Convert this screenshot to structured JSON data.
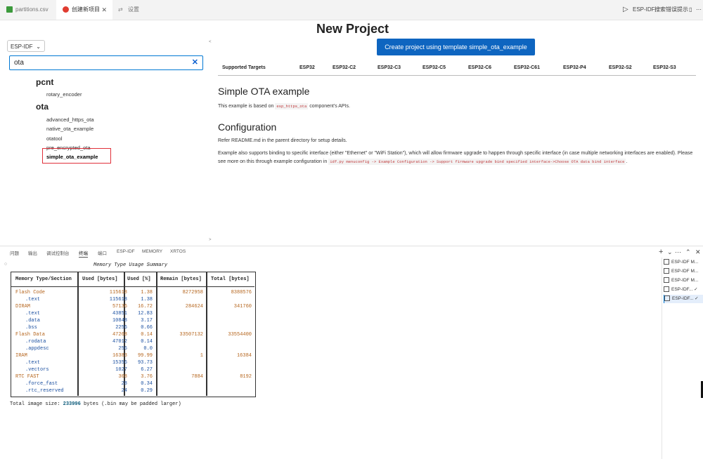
{
  "tabs": [
    {
      "label": "partitions.csv",
      "icon": "csv-file-icon",
      "color": "#3c9a3c"
    },
    {
      "label": "创建新项目",
      "icon": "esp-idf-icon",
      "color": "#e03c31",
      "close": "✕"
    },
    {
      "label": "设置",
      "icon": "settings-icon",
      "color": "#888888"
    }
  ],
  "tab_actions": {
    "run": "▷",
    "esp_idf": "ESP-IDF:",
    "search_errors": "搜索错误提示",
    "split": "▯",
    "more": "⋯"
  },
  "left": {
    "framework_select": "ESP-IDF",
    "search_value": "ota",
    "clear_icon": "✕",
    "groups": [
      {
        "name": "pcnt",
        "examples": [
          "rotary_encoder"
        ]
      },
      {
        "name": "ota",
        "examples": [
          "advanced_https_ota",
          "native_ota_example",
          "otatool",
          "pre_encrypted_ota",
          "simple_ota_example"
        ]
      }
    ],
    "selected_example": "simple_ota_example",
    "pane_markers": [
      "<",
      ">"
    ]
  },
  "right": {
    "title": "New Project",
    "create_button": "Create project using template simple_ota_example",
    "targets_header": "Supported Targets",
    "targets": [
      "ESP32",
      "ESP32-C2",
      "ESP32-C3",
      "ESP32-C5",
      "ESP32-C6",
      "ESP32-C61",
      "ESP32-P4",
      "ESP32-S2",
      "ESP32-S3"
    ],
    "heading": "Simple OTA example",
    "based_on_prefix": "This example is based on",
    "based_on_code": "esp_https_ota",
    "based_on_suffix": "component's APIs.",
    "config_heading": "Configuration",
    "config_text": "Refer README.md in the parent directory for setup details.",
    "config_para_1": "Example also supports binding to specific interface (either \"Ethernet\" or \"WiFi Station\"), which will allow firmware upgrade to happen through specific interface (in case multiple networking interfaces are enabled). Please see more on this through example configuration in",
    "config_code": "idf.py menuconfig -> Example Configuration -> Support firmware upgrade bind specified interface->Choose OTA data bind interface",
    "config_para_end": "."
  },
  "panel": {
    "tabs": [
      "问题",
      "输出",
      "调试控制台",
      "终端",
      "端口",
      "ESP-IDF",
      "MEMORY",
      "XRTOS"
    ],
    "active_tab": "终端",
    "controls": {
      "add": "+",
      "dropdown": "⌄",
      "more": "⋯",
      "maximize": "⌃",
      "close": "✕"
    }
  },
  "terminal": {
    "summary_title": "Memory Type Usage Summary",
    "headers": [
      "Memory Type/Section",
      "Used [bytes]",
      "Used [%]",
      "Remain [bytes]",
      "Total [bytes]"
    ],
    "rows": [
      {
        "name": "Flash Code",
        "used": "115618",
        "pct": "1.38",
        "remain": "8272958",
        "total": "8388576",
        "sub": false
      },
      {
        "name": ".text",
        "used": "115618",
        "pct": "1.38",
        "remain": "",
        "total": "",
        "sub": true
      },
      {
        "name": "DIRAM",
        "used": "57136",
        "pct": "16.72",
        "remain": "284624",
        "total": "341760",
        "sub": false
      },
      {
        "name": ".text",
        "used": "43851",
        "pct": "12.83",
        "remain": "",
        "total": "",
        "sub": true
      },
      {
        "name": ".data",
        "used": "10848",
        "pct": "3.17",
        "remain": "",
        "total": "",
        "sub": true
      },
      {
        "name": ".bss",
        "used": "2256",
        "pct": "0.66",
        "remain": "",
        "total": "",
        "sub": true
      },
      {
        "name": "Flash Data",
        "used": "47268",
        "pct": "0.14",
        "remain": "33507132",
        "total": "33554400",
        "sub": false
      },
      {
        "name": ".rodata",
        "used": "47012",
        "pct": "0.14",
        "remain": "",
        "total": "",
        "sub": true
      },
      {
        "name": ".appdesc",
        "used": "256",
        "pct": "0.0",
        "remain": "",
        "total": "",
        "sub": true
      },
      {
        "name": "IRAM",
        "used": "16383",
        "pct": "99.99",
        "remain": "1",
        "total": "16384",
        "sub": false
      },
      {
        "name": ".text",
        "used": "15356",
        "pct": "93.73",
        "remain": "",
        "total": "",
        "sub": true
      },
      {
        "name": ".vectors",
        "used": "1027",
        "pct": "6.27",
        "remain": "",
        "total": "",
        "sub": true
      },
      {
        "name": "RTC FAST",
        "used": "308",
        "pct": "3.76",
        "remain": "7884",
        "total": "8192",
        "sub": false
      },
      {
        "name": ".force_fast",
        "used": "28",
        "pct": "0.34",
        "remain": "",
        "total": "",
        "sub": true
      },
      {
        "name": ".rtc_reserved",
        "used": "24",
        "pct": "0.29",
        "remain": "",
        "total": "",
        "sub": true
      }
    ],
    "total_prefix": "Total image size:",
    "total_value": "233996",
    "total_suffix": "bytes (.bin may be padded larger)",
    "prompt_marker": "○"
  },
  "terminal_list": [
    {
      "label": "ESP-IDF M...",
      "check": ""
    },
    {
      "label": "ESP-IDF M...",
      "check": ""
    },
    {
      "label": "ESP-IDF M...",
      "check": ""
    },
    {
      "label": "ESP-IDF...",
      "check": "✓"
    },
    {
      "label": "ESP-IDF...",
      "check": "✓"
    }
  ],
  "colors": {
    "accent": "#0e65c0",
    "name_orange": "#b5651d",
    "num_blue": "#1a4fa0",
    "highlight_red": "#e0303a"
  }
}
